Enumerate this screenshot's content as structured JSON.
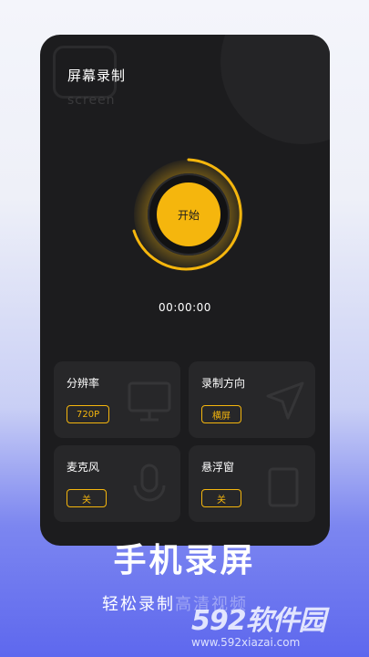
{
  "app": {
    "title": "屏幕录制",
    "watermark": "screen",
    "start_label": "开始",
    "timer": "00:00:00"
  },
  "cards": [
    {
      "label": "分辨率",
      "value": "720P",
      "icon": "monitor-icon"
    },
    {
      "label": "录制方向",
      "value": "横屏",
      "icon": "arrow-pointer-icon"
    },
    {
      "label": "麦克风",
      "value": "关",
      "icon": "microphone-icon"
    },
    {
      "label": "悬浮窗",
      "value": "关",
      "icon": "tablet-icon"
    }
  ],
  "promo": {
    "headline": "手机录屏",
    "subhead_main": "轻松录制",
    "subhead_faded": "高清视频"
  },
  "site": {
    "brand": "592软件园",
    "url": "www.592xiazai.com"
  },
  "colors": {
    "accent": "#f5b60d",
    "panel": "#1c1c1e",
    "card": "#272729"
  }
}
